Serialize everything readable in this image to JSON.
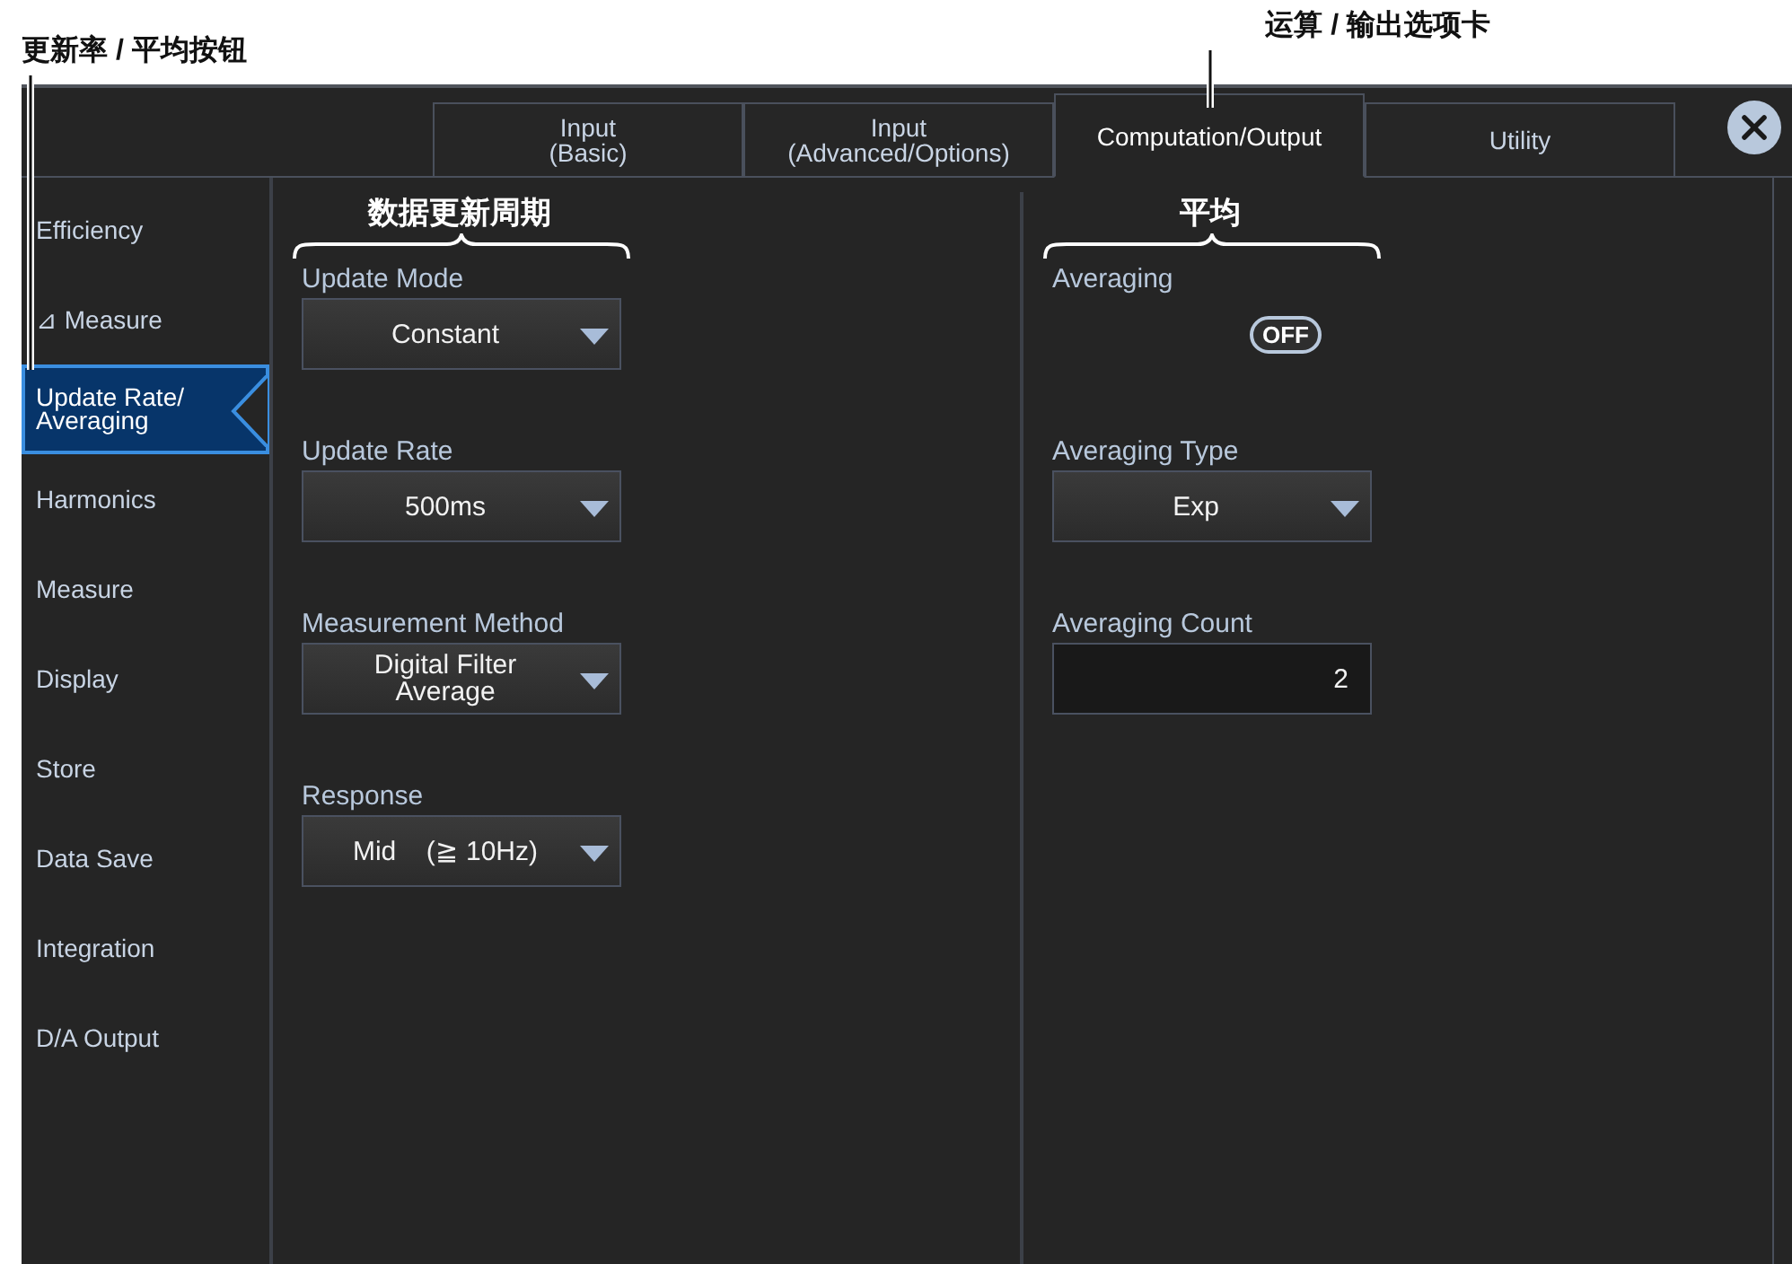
{
  "callouts": {
    "sidebar_button": "更新率 / 平均按钮",
    "tab": "运算 / 输出选项卡"
  },
  "tabs": [
    {
      "label": "Input\n(Basic)",
      "selected": false
    },
    {
      "label": "Input\n(Advanced/Options)",
      "selected": false
    },
    {
      "label": "Computation/Output",
      "selected": true
    },
    {
      "label": "Utility",
      "selected": false
    }
  ],
  "sidebar": {
    "items": [
      {
        "label": "Efficiency",
        "selected": false
      },
      {
        "label": "⊿ Measure",
        "selected": false
      },
      {
        "label": "Update Rate/\nAveraging",
        "selected": true
      },
      {
        "label": "Harmonics",
        "selected": false
      },
      {
        "label": "Measure",
        "selected": false
      },
      {
        "label": "Display",
        "selected": false
      },
      {
        "label": "Store",
        "selected": false
      },
      {
        "label": "Data Save",
        "selected": false
      },
      {
        "label": "Integration",
        "selected": false
      },
      {
        "label": "D/A Output",
        "selected": false
      }
    ]
  },
  "sections": [
    {
      "heading": "数据更新周期",
      "fields": [
        {
          "kind": "dropdown",
          "label": "Update Mode",
          "value": "Constant"
        },
        {
          "kind": "dropdown",
          "label": "Update Rate",
          "value": "500ms"
        },
        {
          "kind": "dropdown",
          "label": "Measurement Method",
          "value": "Digital Filter\nAverage"
        },
        {
          "kind": "dropdown",
          "label": "Response",
          "value": "Mid    (≧ 10Hz)"
        }
      ]
    },
    {
      "heading": "平均",
      "fields": [
        {
          "kind": "toggle",
          "label": "Averaging",
          "on": false,
          "value": "OFF"
        },
        {
          "kind": "dropdown",
          "label": "Averaging Type",
          "value": "Exp"
        },
        {
          "kind": "number",
          "label": "Averaging Count",
          "value": "2"
        }
      ]
    }
  ]
}
